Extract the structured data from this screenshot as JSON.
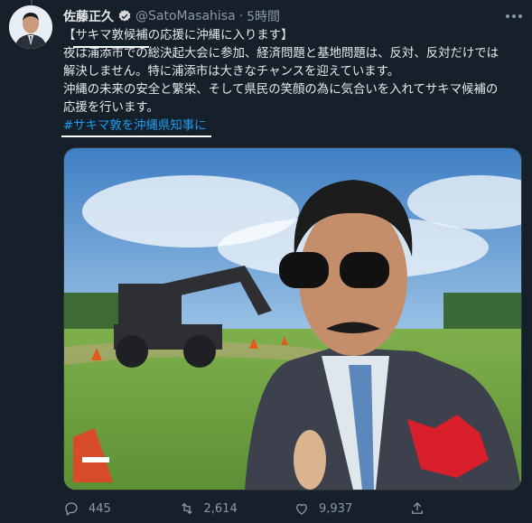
{
  "tweet": {
    "author_name": "佐藤正久",
    "handle": "@SatoMasahisa",
    "separator": "·",
    "time": "5時間",
    "lines": [
      "【サキマ敦候補の応援に沖縄に入ります】",
      "夜は浦添市での総決起大会に参加、経済問題と基地問題は、反対、反対だけでは",
      "解決しません。特に浦添市は大きなチャンスを迎えています。",
      "沖縄の未来の安全と繁栄、そして県民の笑顔の為に気合いを入れてサキマ候補の",
      "応援を行います。"
    ],
    "hashtag": "#サキマ敦を沖縄県知事に"
  },
  "actions": {
    "replies": "445",
    "retweets": "2,614",
    "likes": "9,937"
  },
  "colors": {
    "background": "#15202b",
    "text": "#e7e9ea",
    "muted": "#8b98a5",
    "accent": "#1d9bf0"
  },
  "icons": {
    "more": "more-icon",
    "verified": "verified-badge-icon",
    "reply": "reply-icon",
    "retweet": "retweet-icon",
    "like": "heart-icon",
    "share": "share-icon"
  }
}
